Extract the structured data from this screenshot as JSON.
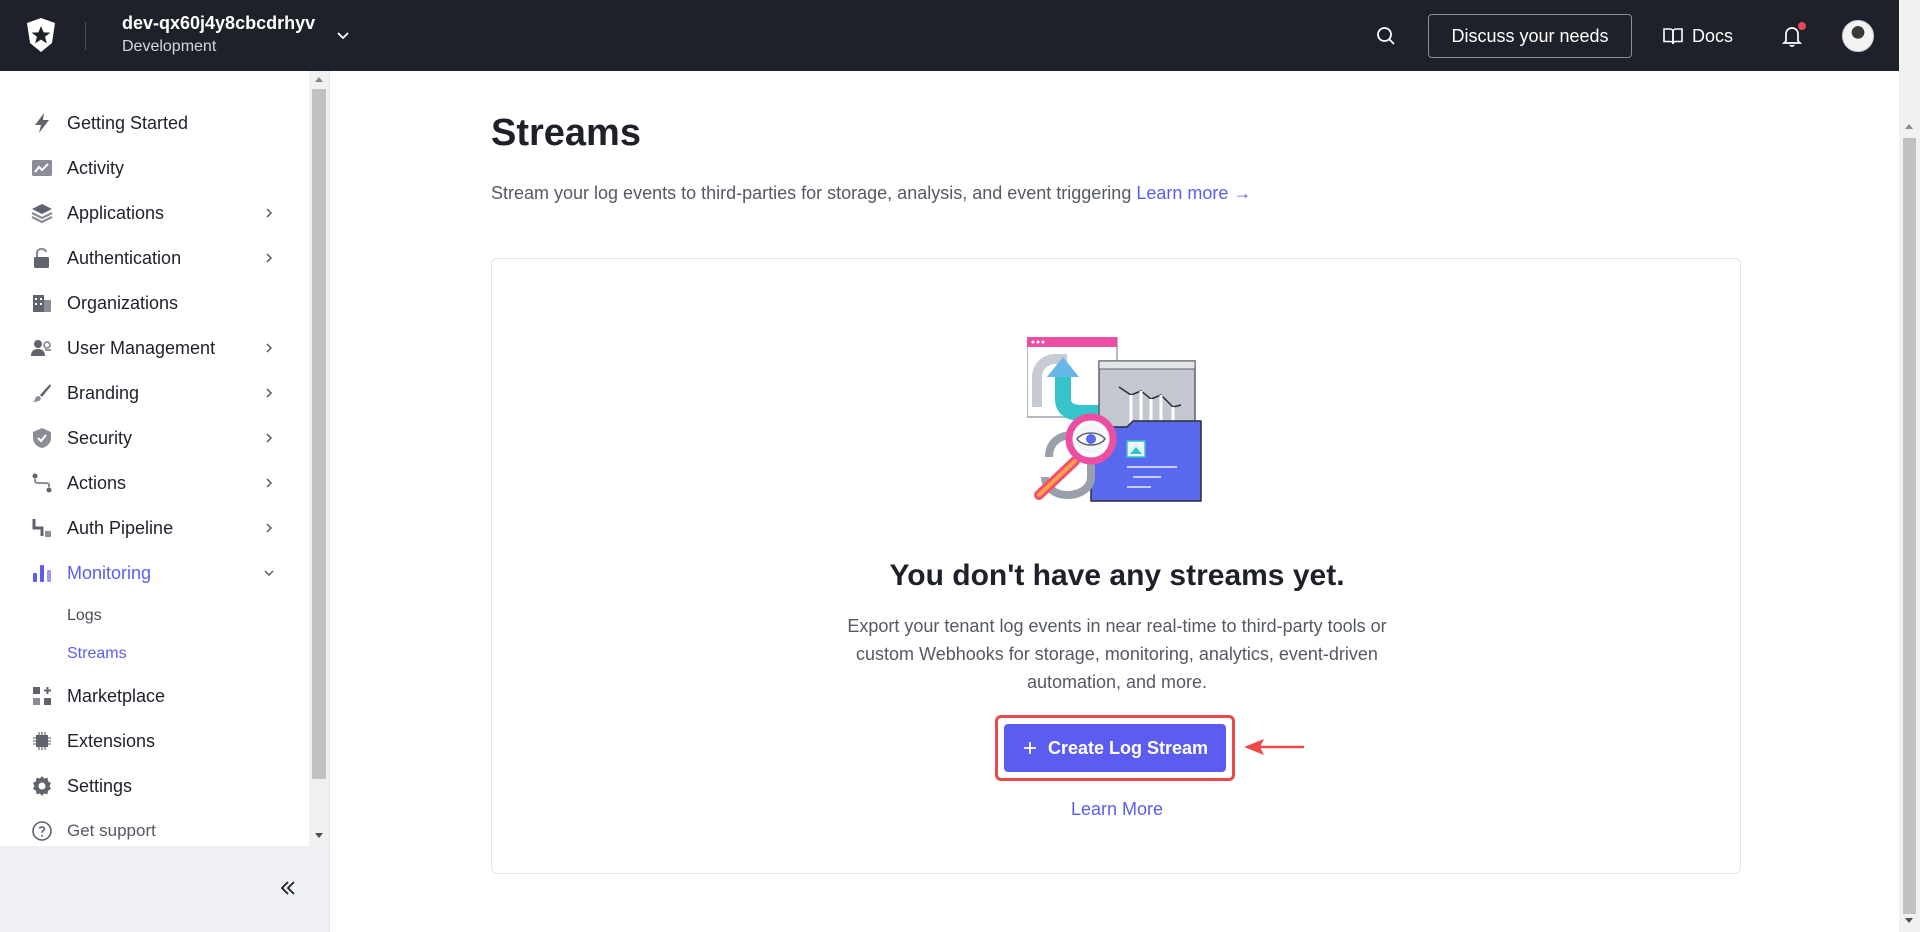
{
  "topbar": {
    "tenant_name": "dev-qx60j4y8cbcdrhyv",
    "tenant_env": "Development",
    "discuss_label": "Discuss your needs",
    "docs_label": "Docs",
    "brand_color": "#1e212a",
    "notification_dot_color": "#e8455a"
  },
  "sidebar": {
    "items": [
      {
        "label": "Getting Started",
        "icon": "lightning-icon"
      },
      {
        "label": "Activity",
        "icon": "activity-chart-icon"
      },
      {
        "label": "Applications",
        "icon": "layers-icon"
      },
      {
        "label": "Authentication",
        "icon": "lock-icon"
      },
      {
        "label": "Organizations",
        "icon": "building-icon"
      },
      {
        "label": "User Management",
        "icon": "users-icon"
      },
      {
        "label": "Branding",
        "icon": "brush-icon"
      },
      {
        "label": "Security",
        "icon": "shield-icon"
      },
      {
        "label": "Actions",
        "icon": "actions-icon"
      },
      {
        "label": "Auth Pipeline",
        "icon": "pipeline-icon"
      },
      {
        "label": "Monitoring",
        "icon": "bar-chart-icon"
      },
      {
        "label": "Marketplace",
        "icon": "grid-plus-icon"
      },
      {
        "label": "Extensions",
        "icon": "chip-icon"
      },
      {
        "label": "Settings",
        "icon": "gear-icon"
      }
    ],
    "sub_items": [
      "Logs",
      "Streams"
    ],
    "support_label": "Get support",
    "active_color": "#5c5cf0"
  },
  "main": {
    "title": "Streams",
    "description": "Stream your log events to third-parties for storage, analysis, and event triggering",
    "description_link": "Learn more →",
    "empty_title": "You don't have any streams yet.",
    "empty_description": "Export your tenant log events in near real-time to third-party tools or custom Webhooks for storage, monitoring, analytics, event-driven automation, and more.",
    "create_button": "Create Log Stream",
    "learn_more": "Learn More",
    "accent_color": "#5c5cf0",
    "annotation_color": "#ea4a4a"
  }
}
